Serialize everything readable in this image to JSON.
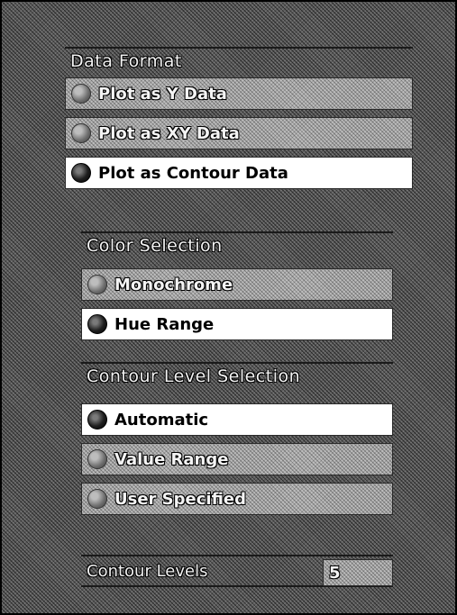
{
  "data_format": {
    "title": "Data Format",
    "options": [
      {
        "label": "Plot as Y Data",
        "selected": false
      },
      {
        "label": "Plot as XY Data",
        "selected": false
      },
      {
        "label": "Plot as Contour Data",
        "selected": true
      }
    ]
  },
  "color_selection": {
    "title": "Color Selection",
    "options": [
      {
        "label": "Monochrome",
        "selected": false
      },
      {
        "label": "Hue Range",
        "selected": true
      }
    ]
  },
  "contour_level_selection": {
    "title": "Contour Level Selection",
    "options": [
      {
        "label": "Automatic",
        "selected": true
      },
      {
        "label": "Value Range",
        "selected": false
      },
      {
        "label": "User Specified",
        "selected": false
      }
    ]
  },
  "contour_levels": {
    "label": "Contour Levels",
    "value": "5"
  }
}
